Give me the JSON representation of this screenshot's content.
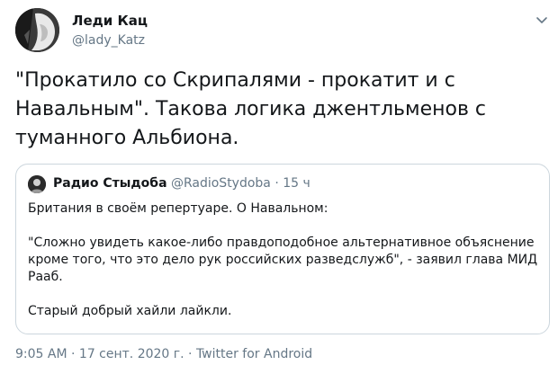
{
  "tweet": {
    "author_name": "Леди Кац",
    "author_handle": "@lady_Katz",
    "text": "\"Прокатило со Скрипалями - прокатит и с Навальным\". Такова логика джентльменов с туманного Альбиона."
  },
  "quoted": {
    "author_name": "Радио Стыдоба",
    "author_handle": "@RadioStydoba",
    "separator": "·",
    "time": "15 ч",
    "line1": "Британия в своём репертуаре. О Навальном:",
    "line2": "\"Сложно увидеть какое-либо правдоподобное альтернативное объяснение",
    "line3": "кроме того, что это дело рук российских разведслужб\", - заявил глава МИД",
    "line4": "Рааб.",
    "line5": "Старый добрый хайли лайкли."
  },
  "footer": {
    "time": "9:05 AM",
    "separator1": "·",
    "date": "17 сент. 2020 г.",
    "separator2": "·",
    "source": "Twitter for Android"
  },
  "icons": {
    "caret": "chevron-down-icon",
    "avatar": "avatar",
    "quoted_avatar": "avatar"
  },
  "colors": {
    "text": "#14171a",
    "secondary": "#657786",
    "border": "#ccd6dd"
  }
}
